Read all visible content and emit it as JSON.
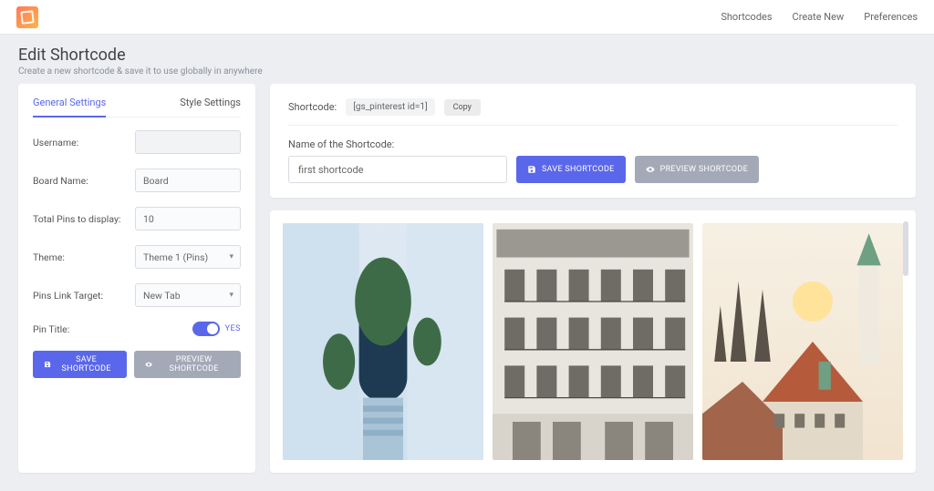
{
  "topnav": {
    "items": [
      "Shortcodes",
      "Create New",
      "Preferences"
    ]
  },
  "page": {
    "title": "Edit Shortcode",
    "subtitle": "Create a new shortcode & save it to use globally in anywhere"
  },
  "tabs": {
    "general": "General Settings",
    "style": "Style Settings"
  },
  "fields": {
    "username_label": "Username:",
    "username_value": "",
    "board_label": "Board Name:",
    "board_value": "Board",
    "total_label": "Total Pins to display:",
    "total_value": "10",
    "theme_label": "Theme:",
    "theme_value": "Theme 1 (Pins)",
    "target_label": "Pins Link Target:",
    "target_value": "New Tab",
    "pintitle_label": "Pin Title:",
    "pintitle_state": "YES"
  },
  "buttons": {
    "save": "SAVE SHORTCODE",
    "preview": "PREVIEW SHORTCODE",
    "copy": "Copy"
  },
  "shortcode": {
    "label": "Shortcode:",
    "value": "[gs_pinterest id=1]",
    "name_label": "Name of the Shortcode:",
    "name_value": "first shortcode"
  }
}
